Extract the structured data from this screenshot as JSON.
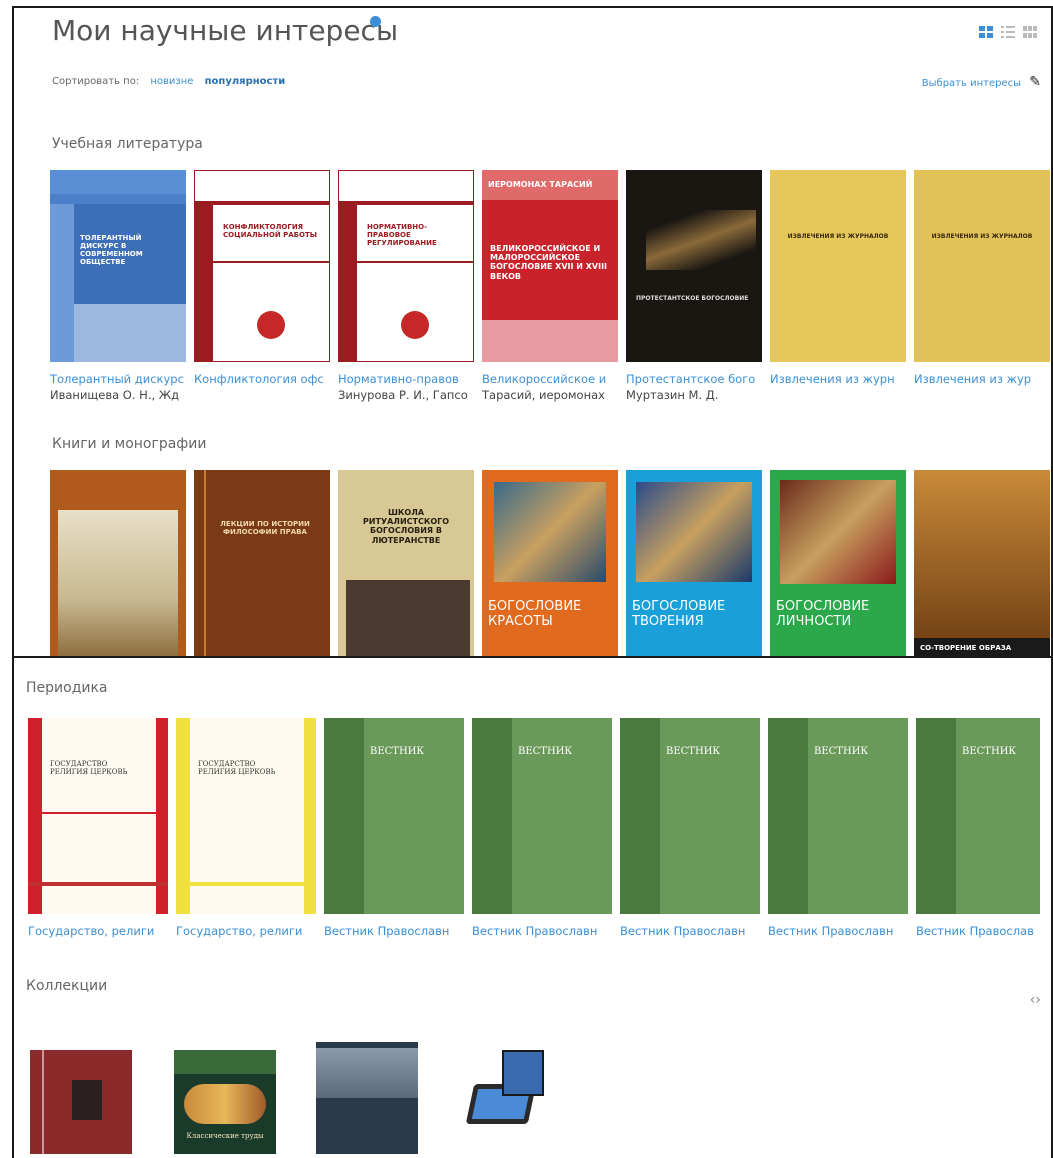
{
  "header": {
    "title": "Мои научные интересы",
    "sort_label": "Сортировать по:",
    "sort_options": [
      "новизне",
      "популярности"
    ],
    "select_interests": "Выбрать интересы"
  },
  "sections": {
    "study": {
      "title": "Учебная литература",
      "items": [
        {
          "title": "Толерантный дискурс",
          "author": "Иванищева О. Н., Жд",
          "cover_text": "ТОЛЕРАНТНЫЙ ДИСКУРС В СОВРЕМЕННОМ ОБЩЕСТВЕ"
        },
        {
          "title": "Конфликтология офс",
          "author": "",
          "cover_text": "КОНФЛИКТОЛОГИЯ СОЦИАЛЬНОЙ РАБОТЫ"
        },
        {
          "title": "Нормативно-правов",
          "author": "Зинурова Р. И., Гапсо",
          "cover_text": "НОРМАТИВНО-ПРАВОВОЕ РЕГУЛИРОВАНИЕ"
        },
        {
          "title": "Великороссийское и",
          "author": "Тарасий, иеромонах",
          "cover_text": "ВЕЛИКОРОССИЙСКОЕ И МАЛОРОССИЙСКОЕ БОГОСЛОВИЕ XVII И XVIII ВЕКОВ",
          "cover_top": "ИЕРОМОНАХ ТАРАСИЙ"
        },
        {
          "title": "Протестантское бого",
          "author": "Муртазин М. Д.",
          "cover_text": "ПРОТЕСТАНТСКОЕ БОГОСЛОВИЕ"
        },
        {
          "title": "Извлечения из журн",
          "author": "",
          "cover_text": "ИЗВЛЕЧЕНИЯ ИЗ ЖУРНАЛОВ"
        },
        {
          "title": "Извлечения из жур",
          "author": "",
          "cover_text": "ИЗВЛЕЧЕНИЯ ИЗ ЖУРНАЛОВ"
        }
      ]
    },
    "books": {
      "title": "Книги и монографии",
      "items": [
        {
          "cover_text": ""
        },
        {
          "cover_text": "ЛЕКЦИИ ПО ИСТОРИИ ФИЛОСОФИИ ПРАВА"
        },
        {
          "cover_text": "ШКОЛА РИТУАЛИСТСКОГО БОГОСЛОВИЯ В ЛЮТЕРАНСТВЕ"
        },
        {
          "cover_text": "БОГОСЛОВИЕ КРАСОТЫ"
        },
        {
          "cover_text": "БОГОСЛОВИЕ ТВОРЕНИЯ"
        },
        {
          "cover_text": "БОГОСЛОВИЕ ЛИЧНОСТИ"
        },
        {
          "cover_text": "СО-ТВОРЕНИЕ ОБРАЗА"
        }
      ]
    },
    "periodicals": {
      "title": "Периодика",
      "items": [
        {
          "title": "Государство, религи",
          "cover_text": "ГОСУДАРСТВО РЕЛИГИЯ ЦЕРКОВЬ"
        },
        {
          "title": "Государство, религи",
          "cover_text": "ГОСУДАРСТВО РЕЛИГИЯ ЦЕРКОВЬ"
        },
        {
          "title": "Вестник Православн",
          "cover_text": "ВЕСТНИК"
        },
        {
          "title": "Вестник Православн",
          "cover_text": "ВЕСТНИК"
        },
        {
          "title": "Вестник Православн",
          "cover_text": "ВЕСТНИК"
        },
        {
          "title": "Вестник Православн",
          "cover_text": "ВЕСТНИК"
        },
        {
          "title": "Вестник Православ",
          "cover_text": "ВЕСТНИК"
        }
      ]
    },
    "collections": {
      "title": "Коллекции",
      "nav": "‹›",
      "items": [
        {
          "cover_text": ""
        },
        {
          "cover_text": "Классические труды"
        },
        {
          "cover_text": ""
        },
        {
          "cover_text": ""
        }
      ]
    }
  },
  "colors": {
    "link": "#3a8fd6",
    "border": "#1a1a1a"
  }
}
